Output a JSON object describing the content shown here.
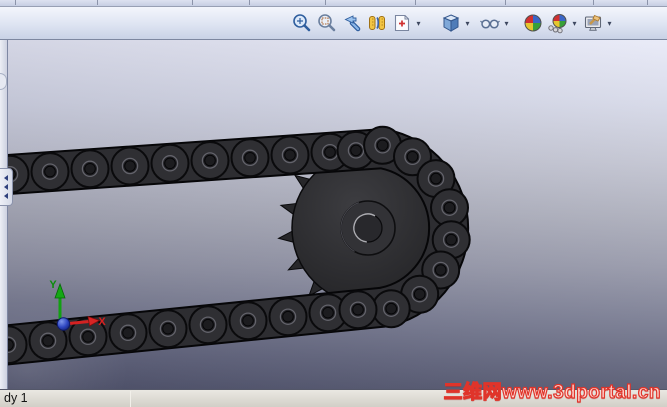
{
  "toolbar": {
    "icons": [
      {
        "name": "zoom-to-fit",
        "dropdown": false,
        "gap_before": 0
      },
      {
        "name": "zoom-to-area",
        "dropdown": false,
        "gap_before": 0
      },
      {
        "name": "previous-view",
        "dropdown": false,
        "gap_before": 0
      },
      {
        "name": "section-view",
        "dropdown": false,
        "gap_before": 0
      },
      {
        "name": "view-orientation",
        "dropdown": true,
        "gap_before": 0
      },
      {
        "name": "display-style",
        "dropdown": true,
        "gap_before": 14
      },
      {
        "name": "hide-show-items",
        "dropdown": true,
        "gap_before": 4
      },
      {
        "name": "edit-appearance",
        "dropdown": false,
        "gap_before": 8
      },
      {
        "name": "apply-scene",
        "dropdown": true,
        "gap_before": 0
      },
      {
        "name": "view-settings",
        "dropdown": true,
        "gap_before": 0
      }
    ]
  },
  "viewport": {
    "model_name": "roller-chain-and-sprocket",
    "triad": {
      "x_label": "X",
      "y_label": "Y",
      "x_color": "#d82222",
      "y_color": "#0e9a0e",
      "z_color": "#2038b8"
    }
  },
  "left_panel": {
    "collapse_arrows": 3
  },
  "status_bar": {
    "document_label": "dy 1"
  },
  "watermark": {
    "text": "三维网www.3dportal.cn",
    "fill": "#ffd6d0",
    "outline": "#e0342a"
  }
}
